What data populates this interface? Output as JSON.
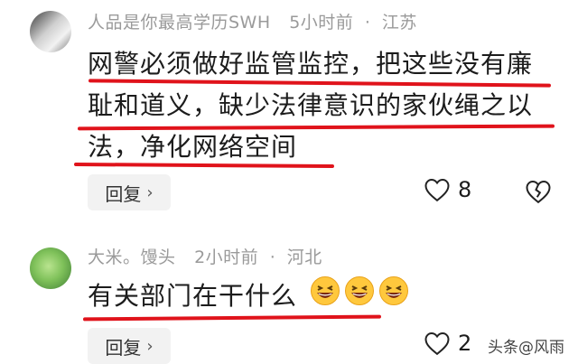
{
  "comments": [
    {
      "username": "人品是你最高学历SWH",
      "time": "5小时前",
      "location": "江苏",
      "separator": "·",
      "lines": [
        "网警必须做好监管监控，把这些没有廉",
        "耻和道义，缺少法律意识的家伙绳之以",
        "法，净化网络空间"
      ],
      "reply_label": "回复",
      "like_count": "8"
    },
    {
      "username": "大米。馒头",
      "time": "2小时前",
      "location": "河北",
      "separator": "·",
      "text": "有关部门在干什么",
      "emojis": [
        "grinning-face-icon",
        "grinning-face-icon",
        "grinning-face-icon"
      ],
      "reply_label": "回复",
      "like_count": "2"
    }
  ],
  "watermark": "头条@风雨",
  "colors": {
    "underline": "#e0131b",
    "meta": "#9a9a9a"
  }
}
